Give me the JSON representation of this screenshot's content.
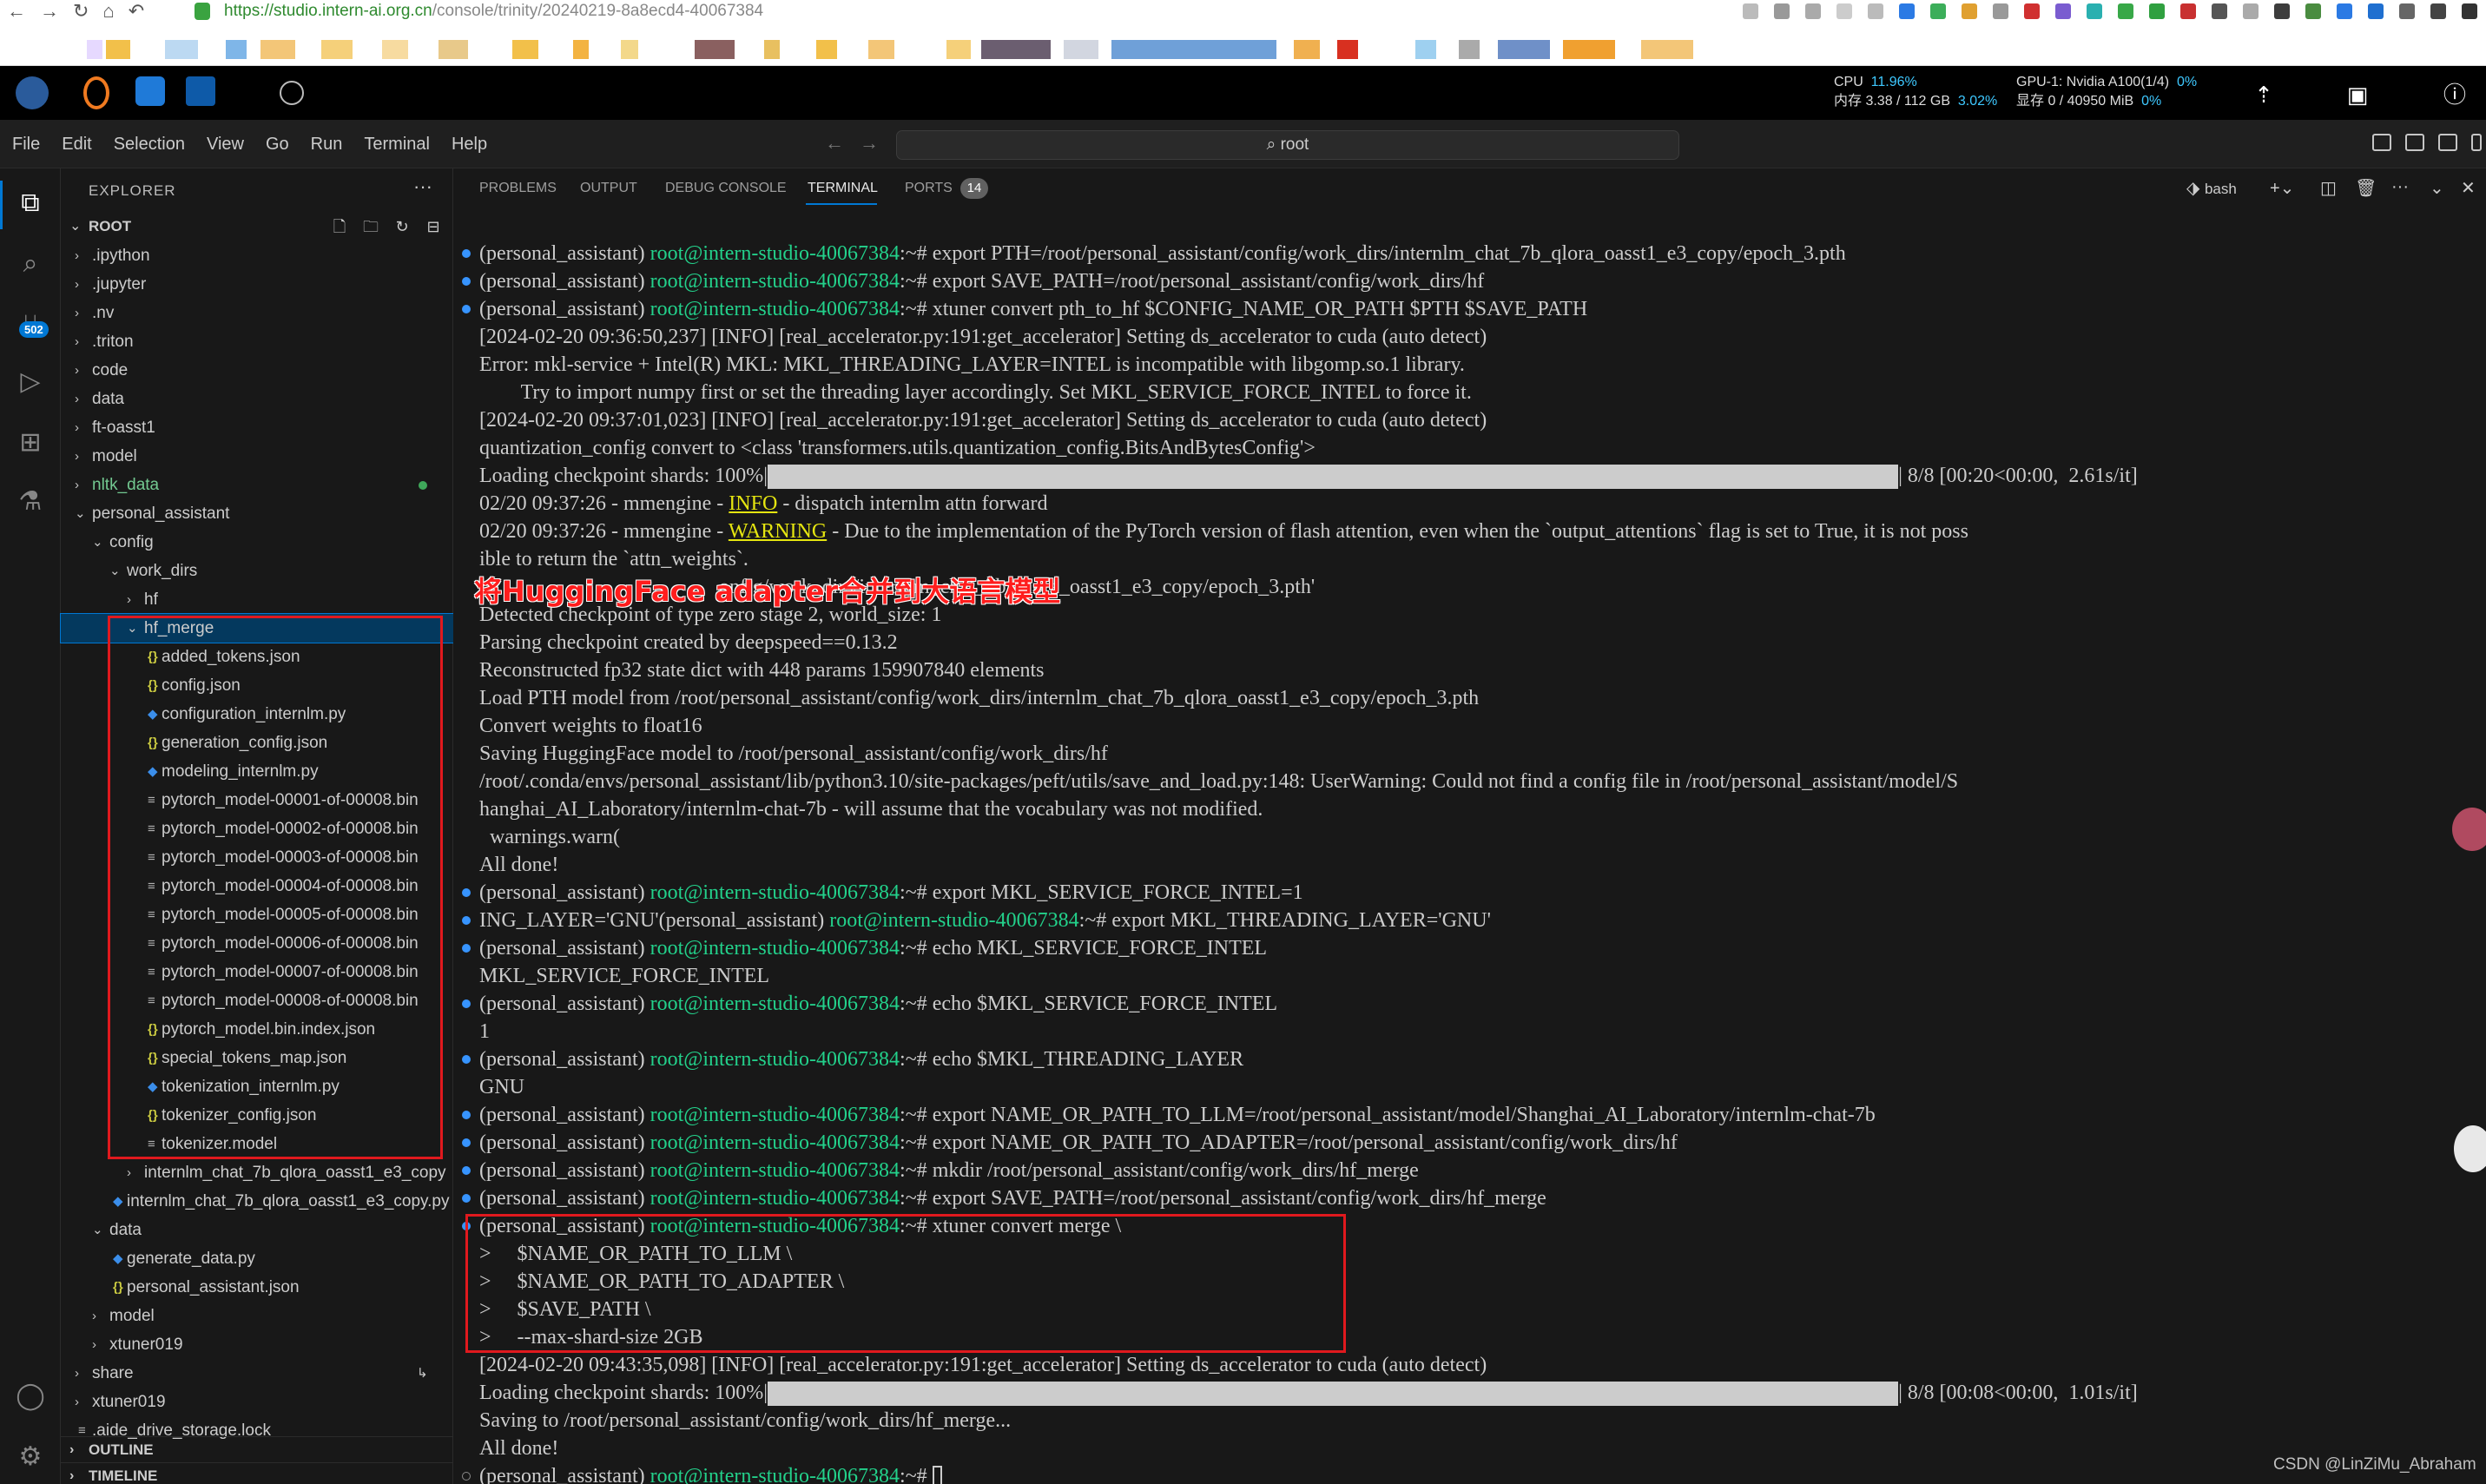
{
  "browser": {
    "url_main": "https://studio.intern-ai.org.cn",
    "url_rest": "/console/trinity/20240219-8a8ecd4-40067384"
  },
  "topbar": {
    "cpu_label": "CPU",
    "cpu_pct": "11.96%",
    "mem_label": "内存 3.38 / 112 GB",
    "mem_pct": "3.02%",
    "gpu_label": "GPU-1: Nvidia A100(1/4)",
    "gpu_pct": "0%",
    "vram_label": "显存 0 / 40950 MiB",
    "vram_pct": "0%"
  },
  "menubar": {
    "items": [
      "File",
      "Edit",
      "Selection",
      "View",
      "Go",
      "Run",
      "Terminal",
      "Help"
    ],
    "command_center": "root"
  },
  "activity": {
    "scm_badge": "502"
  },
  "explorer": {
    "title": "EXPLORER",
    "root": "ROOT",
    "rows": [
      {
        "label": ".ipython",
        "depth": 0,
        "kind": "folder",
        "open": false
      },
      {
        "label": ".jupyter",
        "depth": 0,
        "kind": "folder",
        "open": false
      },
      {
        "label": ".nv",
        "depth": 0,
        "kind": "folder",
        "open": false
      },
      {
        "label": ".triton",
        "depth": 0,
        "kind": "folder",
        "open": false
      },
      {
        "label": "code",
        "depth": 0,
        "kind": "folder",
        "open": false
      },
      {
        "label": "data",
        "depth": 0,
        "kind": "folder",
        "open": false
      },
      {
        "label": "ft-oasst1",
        "depth": 0,
        "kind": "folder",
        "open": false
      },
      {
        "label": "model",
        "depth": 0,
        "kind": "folder",
        "open": false
      },
      {
        "label": "nltk_data",
        "depth": 0,
        "kind": "folder",
        "open": false,
        "modified": true
      },
      {
        "label": "personal_assistant",
        "depth": 0,
        "kind": "folder",
        "open": true
      },
      {
        "label": "config",
        "depth": 1,
        "kind": "folder",
        "open": true
      },
      {
        "label": "work_dirs",
        "depth": 2,
        "kind": "folder",
        "open": true
      },
      {
        "label": "hf",
        "depth": 3,
        "kind": "folder",
        "open": false
      },
      {
        "label": "hf_merge",
        "depth": 3,
        "kind": "folder",
        "open": true,
        "selected": true
      },
      {
        "label": "added_tokens.json",
        "depth": 4,
        "kind": "json"
      },
      {
        "label": "config.json",
        "depth": 4,
        "kind": "json"
      },
      {
        "label": "configuration_internlm.py",
        "depth": 4,
        "kind": "py"
      },
      {
        "label": "generation_config.json",
        "depth": 4,
        "kind": "json"
      },
      {
        "label": "modeling_internlm.py",
        "depth": 4,
        "kind": "py"
      },
      {
        "label": "pytorch_model-00001-of-00008.bin",
        "depth": 4,
        "kind": "bin"
      },
      {
        "label": "pytorch_model-00002-of-00008.bin",
        "depth": 4,
        "kind": "bin"
      },
      {
        "label": "pytorch_model-00003-of-00008.bin",
        "depth": 4,
        "kind": "bin"
      },
      {
        "label": "pytorch_model-00004-of-00008.bin",
        "depth": 4,
        "kind": "bin"
      },
      {
        "label": "pytorch_model-00005-of-00008.bin",
        "depth": 4,
        "kind": "bin"
      },
      {
        "label": "pytorch_model-00006-of-00008.bin",
        "depth": 4,
        "kind": "bin"
      },
      {
        "label": "pytorch_model-00007-of-00008.bin",
        "depth": 4,
        "kind": "bin"
      },
      {
        "label": "pytorch_model-00008-of-00008.bin",
        "depth": 4,
        "kind": "bin"
      },
      {
        "label": "pytorch_model.bin.index.json",
        "depth": 4,
        "kind": "json"
      },
      {
        "label": "special_tokens_map.json",
        "depth": 4,
        "kind": "json"
      },
      {
        "label": "tokenization_internlm.py",
        "depth": 4,
        "kind": "py"
      },
      {
        "label": "tokenizer_config.json",
        "depth": 4,
        "kind": "json"
      },
      {
        "label": "tokenizer.model",
        "depth": 4,
        "kind": "bin"
      },
      {
        "label": "internlm_chat_7b_qlora_oasst1_e3_copy",
        "depth": 3,
        "kind": "folder",
        "open": false
      },
      {
        "label": "internlm_chat_7b_qlora_oasst1_e3_copy.py",
        "depth": 2,
        "kind": "py"
      },
      {
        "label": "data",
        "depth": 1,
        "kind": "folder",
        "open": true
      },
      {
        "label": "generate_data.py",
        "depth": 2,
        "kind": "py"
      },
      {
        "label": "personal_assistant.json",
        "depth": 2,
        "kind": "json"
      },
      {
        "label": "model",
        "depth": 1,
        "kind": "folder",
        "open": false
      },
      {
        "label": "xtuner019",
        "depth": 1,
        "kind": "folder",
        "open": false
      },
      {
        "label": "share",
        "depth": 0,
        "kind": "folder",
        "open": false,
        "link": true
      },
      {
        "label": "xtuner019",
        "depth": 0,
        "kind": "folder",
        "open": false
      },
      {
        "label": ".aide_drive_storage.lock",
        "depth": 0,
        "kind": "plain"
      }
    ],
    "outline": "OUTLINE",
    "timeline": "TIMELINE"
  },
  "panel": {
    "tabs": [
      "PROBLEMS",
      "OUTPUT",
      "DEBUG CONSOLE",
      "TERMINAL",
      "PORTS"
    ],
    "active_tab": "TERMINAL",
    "ports_count": "14",
    "shell": "bash"
  },
  "terminal": {
    "prompt_env": "(personal_assistant) ",
    "prompt_user": "root@intern-studio-40067384",
    "prompt_tail": ":~# ",
    "lines": [
      {
        "t": "cmd",
        "dot": true,
        "cmd": "export PTH=/root/personal_assistant/config/work_dirs/internlm_chat_7b_qlora_oasst1_e3_copy/epoch_3.pth"
      },
      {
        "t": "cmd",
        "dot": true,
        "cmd": "export SAVE_PATH=/root/personal_assistant/config/work_dirs/hf"
      },
      {
        "t": "cmd",
        "dot": true,
        "cmd": "xtuner convert pth_to_hf $CONFIG_NAME_OR_PATH $PTH $SAVE_PATH"
      },
      {
        "t": "out",
        "text": "[2024-02-20 09:36:50,237] [INFO] [real_accelerator.py:191:get_accelerator] Setting ds_accelerator to cuda (auto detect)"
      },
      {
        "t": "out",
        "text": "Error: mkl-service + Intel(R) MKL: MKL_THREADING_LAYER=INTEL is incompatible with libgomp.so.1 library."
      },
      {
        "t": "out",
        "text": "        Try to import numpy first or set the threading layer accordingly. Set MKL_SERVICE_FORCE_INTEL to force it."
      },
      {
        "t": "out",
        "text": "[2024-02-20 09:37:01,023] [INFO] [real_accelerator.py:191:get_accelerator] Setting ds_accelerator to cuda (auto detect)"
      },
      {
        "t": "out",
        "text": "quantization_config convert to <class 'transformers.utils.quantization_config.BitsAndBytesConfig'>"
      },
      {
        "t": "prog",
        "pre": "Loading checkpoint shards: 100%|",
        "post": "| 8/8 [00:20<00:00,  2.61s/it]"
      },
      {
        "t": "log",
        "pre": "02/20 09:37:26 - mmengine - ",
        "level": "INFO",
        "post": " - dispatch internlm attn forward"
      },
      {
        "t": "log",
        "pre": "02/20 09:37:26 - mmengine - ",
        "level": "WARNING",
        "post": " - Due to the implementation of the PyTorch version of flash attention, even when the `output_attentions` flag is set to True, it is not poss"
      },
      {
        "t": "out",
        "text": "ible to return the `attn_weights`."
      },
      {
        "t": "out",
        "text": "                                              onfig/work_dirs/internlm_chat_7b_qlora_oasst1_e3_copy/epoch_3.pth'"
      },
      {
        "t": "out",
        "text": "Detected checkpoint of type zero stage 2, world_size: 1"
      },
      {
        "t": "out",
        "text": "Parsing checkpoint created by deepspeed==0.13.2"
      },
      {
        "t": "out",
        "text": "Reconstructed fp32 state dict with 448 params 159907840 elements"
      },
      {
        "t": "out",
        "text": "Load PTH model from /root/personal_assistant/config/work_dirs/internlm_chat_7b_qlora_oasst1_e3_copy/epoch_3.pth"
      },
      {
        "t": "out",
        "text": "Convert weights to float16"
      },
      {
        "t": "out",
        "text": "Saving HuggingFace model to /root/personal_assistant/config/work_dirs/hf"
      },
      {
        "t": "out",
        "text": "/root/.conda/envs/personal_assistant/lib/python3.10/site-packages/peft/utils/save_and_load.py:148: UserWarning: Could not find a config file in /root/personal_assistant/model/S"
      },
      {
        "t": "out",
        "text": "hanghai_AI_Laboratory/internlm-chat-7b - will assume that the vocabulary was not modified."
      },
      {
        "t": "out",
        "text": "  warnings.warn("
      },
      {
        "t": "out",
        "text": "All done!"
      },
      {
        "t": "cmd",
        "dot": true,
        "cmd": "export MKL_SERVICE_FORCE_INTEL=1"
      },
      {
        "t": "mixed",
        "dot": true,
        "pre": "ING_LAYER='GNU'",
        "cmd": "export MKL_THREADING_LAYER='GNU'"
      },
      {
        "t": "cmd",
        "dot": true,
        "cmd": "echo MKL_SERVICE_FORCE_INTEL"
      },
      {
        "t": "out",
        "text": "MKL_SERVICE_FORCE_INTEL"
      },
      {
        "t": "cmd",
        "dot": true,
        "cmd": "echo $MKL_SERVICE_FORCE_INTEL"
      },
      {
        "t": "out",
        "text": "1"
      },
      {
        "t": "cmd",
        "dot": true,
        "cmd": "echo $MKL_THREADING_LAYER"
      },
      {
        "t": "out",
        "text": "GNU"
      },
      {
        "t": "cmd",
        "dot": true,
        "cmd": "export NAME_OR_PATH_TO_LLM=/root/personal_assistant/model/Shanghai_AI_Laboratory/internlm-chat-7b"
      },
      {
        "t": "cmd",
        "dot": true,
        "cmd": "export NAME_OR_PATH_TO_ADAPTER=/root/personal_assistant/config/work_dirs/hf"
      },
      {
        "t": "cmd",
        "dot": true,
        "cmd": "mkdir /root/personal_assistant/config/work_dirs/hf_merge"
      },
      {
        "t": "cmd",
        "dot": true,
        "cmd": "export SAVE_PATH=/root/personal_assistant/config/work_dirs/hf_merge"
      },
      {
        "t": "cmd",
        "dot": true,
        "cmd": "xtuner convert merge \\"
      },
      {
        "t": "out",
        "text": ">     $NAME_OR_PATH_TO_LLM \\"
      },
      {
        "t": "out",
        "text": ">     $NAME_OR_PATH_TO_ADAPTER \\"
      },
      {
        "t": "out",
        "text": ">     $SAVE_PATH \\"
      },
      {
        "t": "out",
        "text": ">     --max-shard-size 2GB"
      },
      {
        "t": "out",
        "text": "[2024-02-20 09:43:35,098] [INFO] [real_accelerator.py:191:get_accelerator] Setting ds_accelerator to cuda (auto detect)"
      },
      {
        "t": "prog",
        "pre": "Loading checkpoint shards: 100%|",
        "post": "| 8/8 [00:08<00:00,  1.01s/it]"
      },
      {
        "t": "out",
        "text": "Saving to /root/personal_assistant/config/work_dirs/hf_merge..."
      },
      {
        "t": "out",
        "text": "All done!"
      },
      {
        "t": "prompt",
        "dot": true,
        "hollow": true,
        "cmd": ""
      }
    ]
  },
  "annotation": {
    "text": "将HuggingFace adapter合并到大语言模型"
  },
  "watermark": "CSDN @LinZiMu_Abraham"
}
